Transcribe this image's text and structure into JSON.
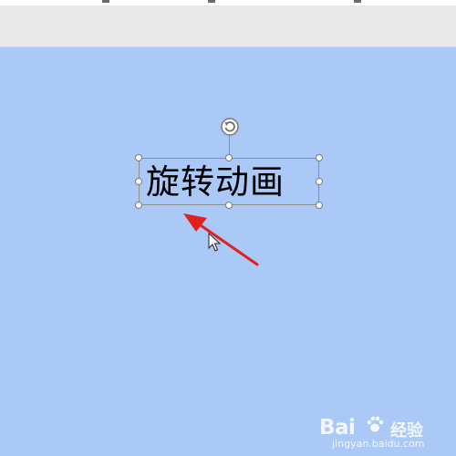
{
  "slide": {
    "background_color": "#aac9f6",
    "textbox_text": "旋转动画"
  },
  "annotation": {
    "arrow_color": "#e0201c"
  },
  "watermark": {
    "logo_text": "Bai",
    "logo_suffix": "经验",
    "url": "jingyan.baidu.com"
  },
  "icons": {
    "rotate_handle": "rotate-icon",
    "cursor": "mouse-pointer-icon",
    "watermark_paw": "baidu-paw-icon"
  }
}
